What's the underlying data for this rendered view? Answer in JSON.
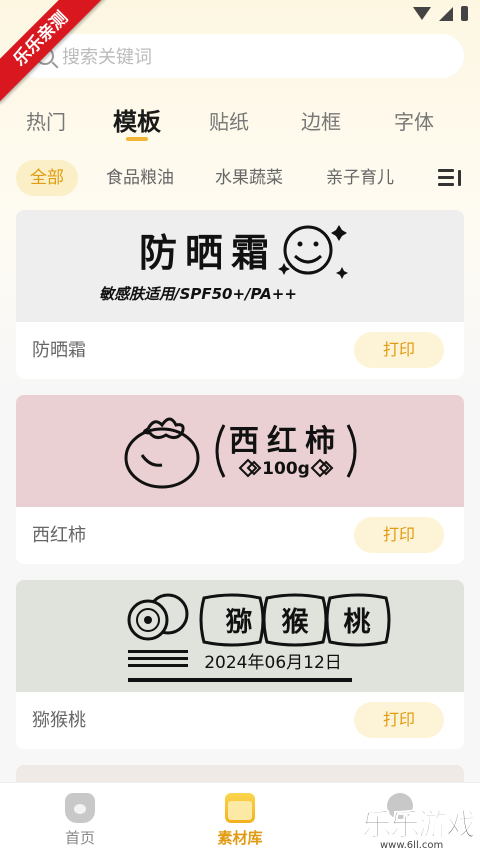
{
  "ribbon": "乐乐亲测",
  "search": {
    "placeholder": "搜索关键词"
  },
  "tabs": [
    "热门",
    "模板",
    "贴纸",
    "边框",
    "字体"
  ],
  "chips": [
    "全部",
    "食品粮油",
    "水果蔬菜",
    "亲子育儿"
  ],
  "cards": [
    {
      "name": "防晒霜",
      "print": "打印",
      "art_title": "防晒霜",
      "art_sub": "敏感肤适用/SPF50+/PA++"
    },
    {
      "name": "西红柿",
      "print": "打印",
      "art_title": "西红柿",
      "art_sub": "100g"
    },
    {
      "name": "猕猴桃",
      "print": "打印",
      "art_title_1": "猕",
      "art_title_2": "猴",
      "art_title_3": "桃",
      "art_sub": "2024年06月12日"
    }
  ],
  "nav": {
    "home": "首页",
    "materials": "素材库"
  },
  "watermark": {
    "big": "乐乐游戏",
    "small": "www.6ll.com"
  },
  "colors": {
    "accent": "#e19b10",
    "card1_bg": "#eeeeee",
    "card2_bg": "#ead0d2",
    "card3_bg": "#dfe3dc"
  }
}
